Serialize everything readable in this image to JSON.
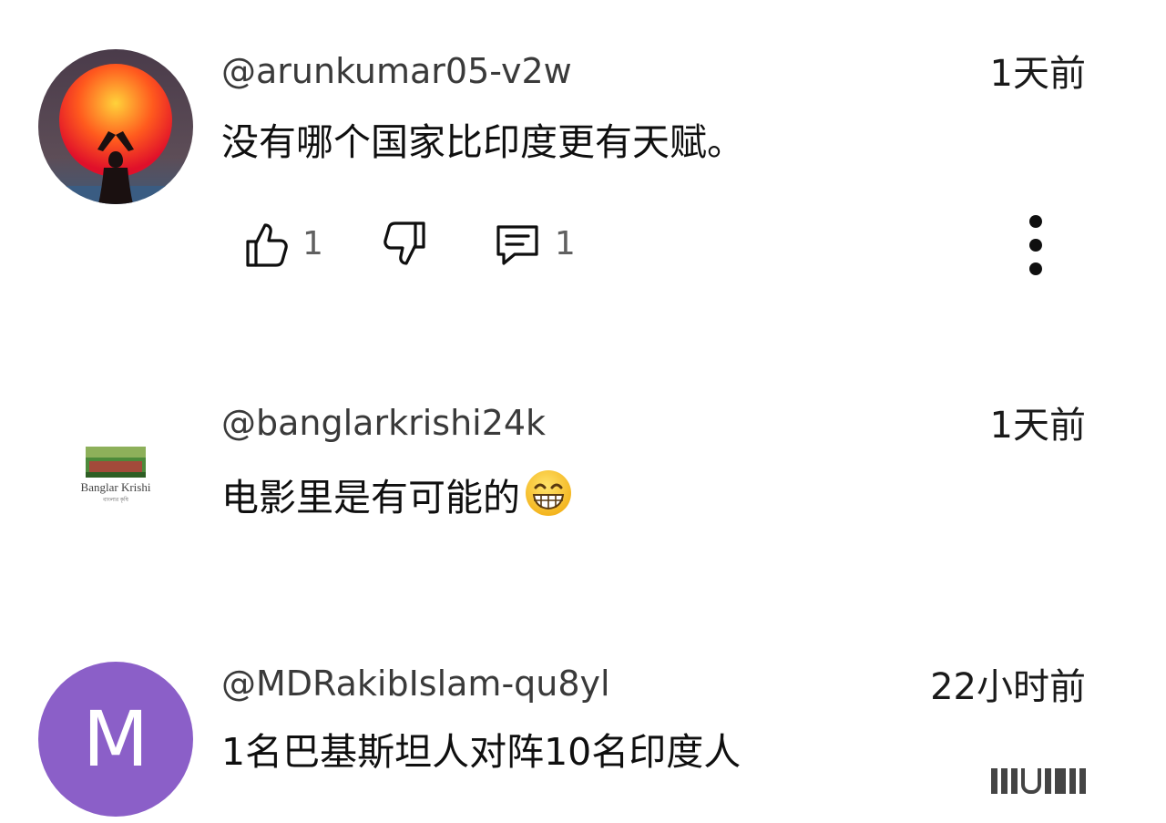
{
  "comments": [
    {
      "handle": "@arunkumar05-v2w",
      "time": "1天前",
      "text": "没有哪个国家比印度更有天赋。",
      "likes": "1",
      "replies": "1",
      "avatar_icon": "sunset-meditation-avatar"
    },
    {
      "handle": "@banglarkrishi24k",
      "time": "1天前",
      "text": "电影里是有可能的",
      "emoji_icon": "grinning-face-icon",
      "avatar_icon": "banglar-krishi-logo"
    },
    {
      "handle": "@MDRakibIslam-qu8yl",
      "time": "22小时前",
      "text": "1名巴基斯坦人对阵10名印度人",
      "avatar_letter": "M",
      "avatar_color": "#8b5fc8"
    }
  ],
  "icons": {
    "like": "thumbs-up-icon",
    "dislike": "thumbs-down-icon",
    "reply": "comment-icon",
    "more": "more-vertical-icon"
  },
  "logo_text": {
    "line1": "Banglar Krishi",
    "line2": "বাংলার কৃষি"
  }
}
